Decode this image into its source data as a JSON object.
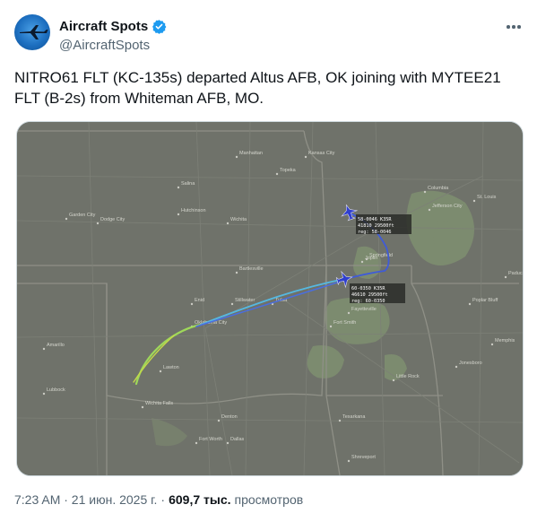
{
  "author": {
    "display_name": "Aircraft Spots",
    "handle": "@AircraftSpots"
  },
  "tweet": {
    "text": "NITRO61 FLT (KC-135s) departed Altus AFB, OK joining with MYTEE21\nFLT (B-2s) from Whiteman AFB, MO."
  },
  "map": {
    "cities": [
      {
        "name": "Kansas City"
      },
      {
        "name": "Topeka"
      },
      {
        "name": "Manhattan"
      },
      {
        "name": "Salina"
      },
      {
        "name": "Wichita"
      },
      {
        "name": "Hutchinson"
      },
      {
        "name": "Dodge City"
      },
      {
        "name": "Garden City"
      },
      {
        "name": "Joplin"
      },
      {
        "name": "Springfield"
      },
      {
        "name": "Tulsa"
      },
      {
        "name": "Bartlesville"
      },
      {
        "name": "Oklahoma City"
      },
      {
        "name": "Lawton"
      },
      {
        "name": "Wichita Falls"
      },
      {
        "name": "Fort Smith"
      },
      {
        "name": "Fayetteville"
      },
      {
        "name": "Little Rock"
      },
      {
        "name": "Memphis"
      },
      {
        "name": "Dallas"
      },
      {
        "name": "Fort Worth"
      },
      {
        "name": "Amarillo"
      },
      {
        "name": "Lubbock"
      },
      {
        "name": "Jefferson City"
      },
      {
        "name": "Columbia"
      },
      {
        "name": "St. Louis"
      },
      {
        "name": "Paducah"
      },
      {
        "name": "Jonesboro"
      },
      {
        "name": "Texarkana"
      },
      {
        "name": "Shreveport"
      },
      {
        "name": "Denton"
      },
      {
        "name": "Enid"
      },
      {
        "name": "Stillwater"
      },
      {
        "name": "Poplar Bluff"
      }
    ],
    "aircraft_labels": [
      {
        "line1": "58-0046 K35R",
        "line2": "41810 29500ft",
        "line3": "reg: 58-0046"
      },
      {
        "line1": "60-0350 K35R",
        "line2": "46610 29500ft",
        "line3": "reg: 60-0350"
      }
    ],
    "colors": {
      "land": "#6f726a",
      "forest": "#7e8e70",
      "state_border": "#8a8b82",
      "road": "#7b7d75",
      "track_blue": "#3f5bd8",
      "track_green": "#8fd65a",
      "track_cyan": "#55c8e0",
      "aircraft": "#2f3fcf"
    }
  },
  "footer": {
    "time_date": "7:23 AM · 21 июн. 2025 г.",
    "views_count": "609,7 тыс.",
    "views_label": "просмотров"
  }
}
